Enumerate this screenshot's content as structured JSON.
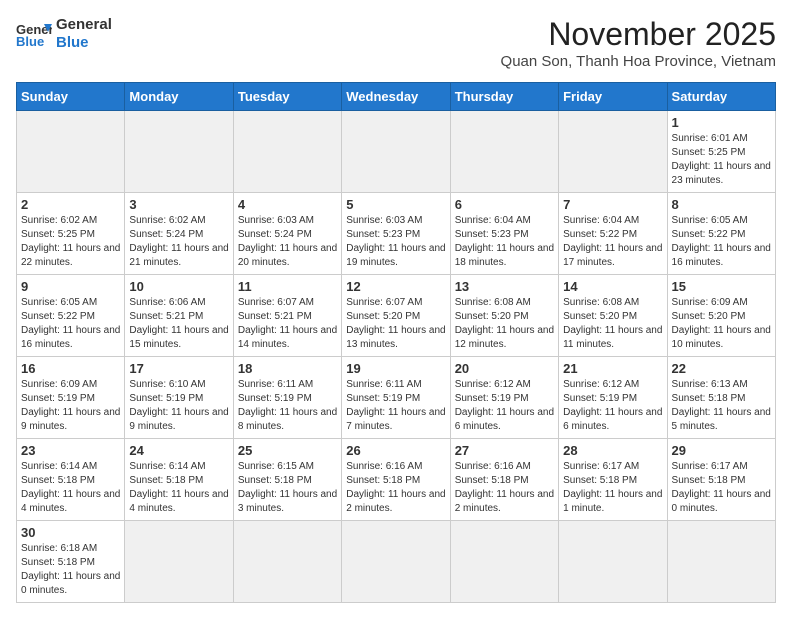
{
  "logo": {
    "line1": "General",
    "line2": "Blue"
  },
  "title": "November 2025",
  "location": "Quan Son, Thanh Hoa Province, Vietnam",
  "days_of_week": [
    "Sunday",
    "Monday",
    "Tuesday",
    "Wednesday",
    "Thursday",
    "Friday",
    "Saturday"
  ],
  "weeks": [
    [
      {
        "day": "",
        "text": ""
      },
      {
        "day": "",
        "text": ""
      },
      {
        "day": "",
        "text": ""
      },
      {
        "day": "",
        "text": ""
      },
      {
        "day": "",
        "text": ""
      },
      {
        "day": "",
        "text": ""
      },
      {
        "day": "1",
        "text": "Sunrise: 6:01 AM\nSunset: 5:25 PM\nDaylight: 11 hours and 23 minutes."
      }
    ],
    [
      {
        "day": "2",
        "text": "Sunrise: 6:02 AM\nSunset: 5:25 PM\nDaylight: 11 hours and 22 minutes."
      },
      {
        "day": "3",
        "text": "Sunrise: 6:02 AM\nSunset: 5:24 PM\nDaylight: 11 hours and 21 minutes."
      },
      {
        "day": "4",
        "text": "Sunrise: 6:03 AM\nSunset: 5:24 PM\nDaylight: 11 hours and 20 minutes."
      },
      {
        "day": "5",
        "text": "Sunrise: 6:03 AM\nSunset: 5:23 PM\nDaylight: 11 hours and 19 minutes."
      },
      {
        "day": "6",
        "text": "Sunrise: 6:04 AM\nSunset: 5:23 PM\nDaylight: 11 hours and 18 minutes."
      },
      {
        "day": "7",
        "text": "Sunrise: 6:04 AM\nSunset: 5:22 PM\nDaylight: 11 hours and 17 minutes."
      },
      {
        "day": "8",
        "text": "Sunrise: 6:05 AM\nSunset: 5:22 PM\nDaylight: 11 hours and 16 minutes."
      }
    ],
    [
      {
        "day": "9",
        "text": "Sunrise: 6:05 AM\nSunset: 5:22 PM\nDaylight: 11 hours and 16 minutes."
      },
      {
        "day": "10",
        "text": "Sunrise: 6:06 AM\nSunset: 5:21 PM\nDaylight: 11 hours and 15 minutes."
      },
      {
        "day": "11",
        "text": "Sunrise: 6:07 AM\nSunset: 5:21 PM\nDaylight: 11 hours and 14 minutes."
      },
      {
        "day": "12",
        "text": "Sunrise: 6:07 AM\nSunset: 5:20 PM\nDaylight: 11 hours and 13 minutes."
      },
      {
        "day": "13",
        "text": "Sunrise: 6:08 AM\nSunset: 5:20 PM\nDaylight: 11 hours and 12 minutes."
      },
      {
        "day": "14",
        "text": "Sunrise: 6:08 AM\nSunset: 5:20 PM\nDaylight: 11 hours and 11 minutes."
      },
      {
        "day": "15",
        "text": "Sunrise: 6:09 AM\nSunset: 5:20 PM\nDaylight: 11 hours and 10 minutes."
      }
    ],
    [
      {
        "day": "16",
        "text": "Sunrise: 6:09 AM\nSunset: 5:19 PM\nDaylight: 11 hours and 9 minutes."
      },
      {
        "day": "17",
        "text": "Sunrise: 6:10 AM\nSunset: 5:19 PM\nDaylight: 11 hours and 9 minutes."
      },
      {
        "day": "18",
        "text": "Sunrise: 6:11 AM\nSunset: 5:19 PM\nDaylight: 11 hours and 8 minutes."
      },
      {
        "day": "19",
        "text": "Sunrise: 6:11 AM\nSunset: 5:19 PM\nDaylight: 11 hours and 7 minutes."
      },
      {
        "day": "20",
        "text": "Sunrise: 6:12 AM\nSunset: 5:19 PM\nDaylight: 11 hours and 6 minutes."
      },
      {
        "day": "21",
        "text": "Sunrise: 6:12 AM\nSunset: 5:19 PM\nDaylight: 11 hours and 6 minutes."
      },
      {
        "day": "22",
        "text": "Sunrise: 6:13 AM\nSunset: 5:18 PM\nDaylight: 11 hours and 5 minutes."
      }
    ],
    [
      {
        "day": "23",
        "text": "Sunrise: 6:14 AM\nSunset: 5:18 PM\nDaylight: 11 hours and 4 minutes."
      },
      {
        "day": "24",
        "text": "Sunrise: 6:14 AM\nSunset: 5:18 PM\nDaylight: 11 hours and 4 minutes."
      },
      {
        "day": "25",
        "text": "Sunrise: 6:15 AM\nSunset: 5:18 PM\nDaylight: 11 hours and 3 minutes."
      },
      {
        "day": "26",
        "text": "Sunrise: 6:16 AM\nSunset: 5:18 PM\nDaylight: 11 hours and 2 minutes."
      },
      {
        "day": "27",
        "text": "Sunrise: 6:16 AM\nSunset: 5:18 PM\nDaylight: 11 hours and 2 minutes."
      },
      {
        "day": "28",
        "text": "Sunrise: 6:17 AM\nSunset: 5:18 PM\nDaylight: 11 hours and 1 minute."
      },
      {
        "day": "29",
        "text": "Sunrise: 6:17 AM\nSunset: 5:18 PM\nDaylight: 11 hours and 0 minutes."
      }
    ],
    [
      {
        "day": "30",
        "text": "Sunrise: 6:18 AM\nSunset: 5:18 PM\nDaylight: 11 hours and 0 minutes."
      },
      {
        "day": "",
        "text": ""
      },
      {
        "day": "",
        "text": ""
      },
      {
        "day": "",
        "text": ""
      },
      {
        "day": "",
        "text": ""
      },
      {
        "day": "",
        "text": ""
      },
      {
        "day": "",
        "text": ""
      }
    ]
  ]
}
